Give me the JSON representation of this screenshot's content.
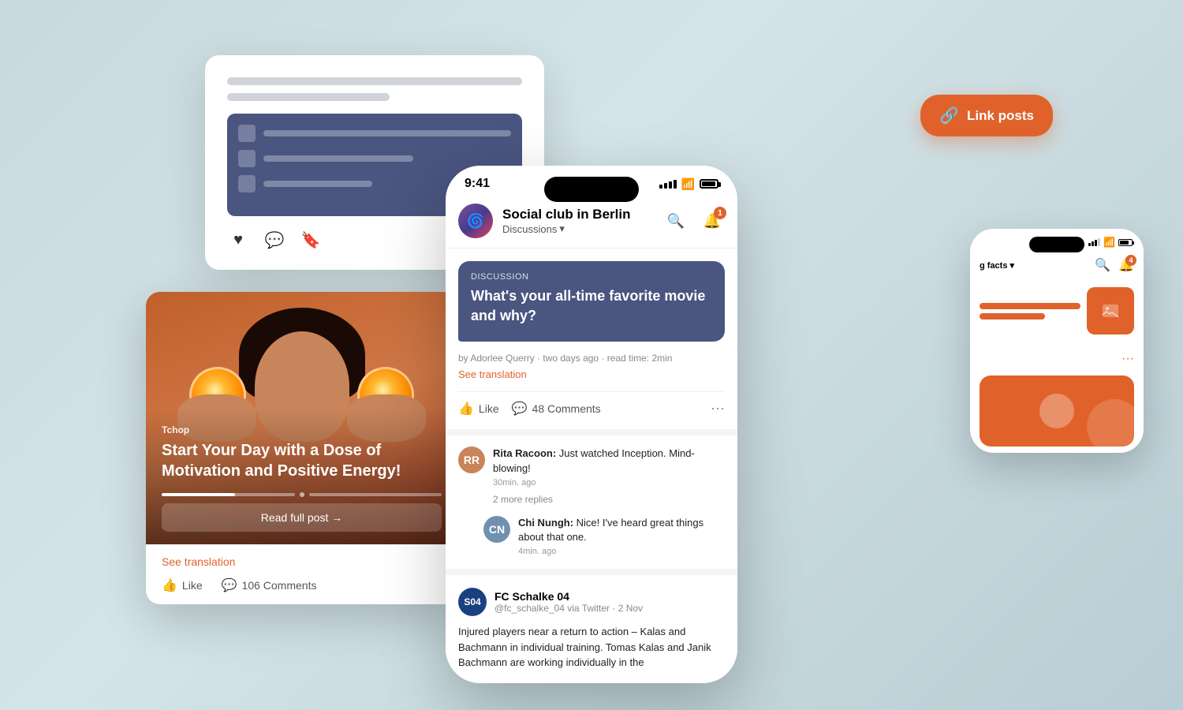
{
  "background": {
    "color": "#d0dde0"
  },
  "link_posts_button": {
    "label": "Link posts",
    "icon": "link-icon"
  },
  "desktop_card": {
    "line1": "",
    "line2": "",
    "image_lines": [
      "",
      "",
      ""
    ],
    "action_icons": [
      "heart",
      "comment",
      "bookmark"
    ]
  },
  "post_card": {
    "tag": "Tchop",
    "title": "Start Your Day with a Dose of Motivation and Positive Energy!",
    "read_btn": "Read full post →",
    "see_translation": "See translation",
    "like_label": "Like",
    "comments_label": "106 Comments"
  },
  "phone_center": {
    "status": {
      "time": "9:41",
      "signal": "4",
      "battery": "85"
    },
    "header": {
      "title": "Social club in Berlin",
      "subtitle": "Discussions",
      "chevron": "▾",
      "search_icon": "search",
      "notification_badge": "1"
    },
    "discussion": {
      "label": "Discussion",
      "question": "What's your all-time favorite movie and why?",
      "meta": "by Adorlee Querry · two days ago · read time: 2min",
      "see_translation": "See translation",
      "like_label": "Like",
      "comments_label": "48 Comments"
    },
    "comments": [
      {
        "author": "Rita Racoon",
        "text": "Just watched Inception. Mind-blowing!",
        "time": "30min. ago",
        "avatar_color": "#c8845a",
        "initials": "RR"
      }
    ],
    "more_replies": "2 more replies",
    "reply": {
      "author": "Chi Nungh",
      "text": "Nice! I've heard great things about that one.",
      "time": "4min. ago",
      "avatar_color": "#7090b0",
      "initials": "CN"
    },
    "twitter_card": {
      "handle": "@fc_schalke_04",
      "source": "via Twitter · 2 Nov",
      "name": "FC Schalke 04",
      "body": "Injured players near a return to action – Kalas and Bachmann in individual training. Tomas Kalas and Janik Bachmann are working individually in the"
    }
  },
  "phone_right": {
    "status": {
      "signal": "3",
      "battery": "70"
    },
    "header": {
      "title": "g facts",
      "chevron": "▾",
      "notification_badge": "4"
    }
  }
}
